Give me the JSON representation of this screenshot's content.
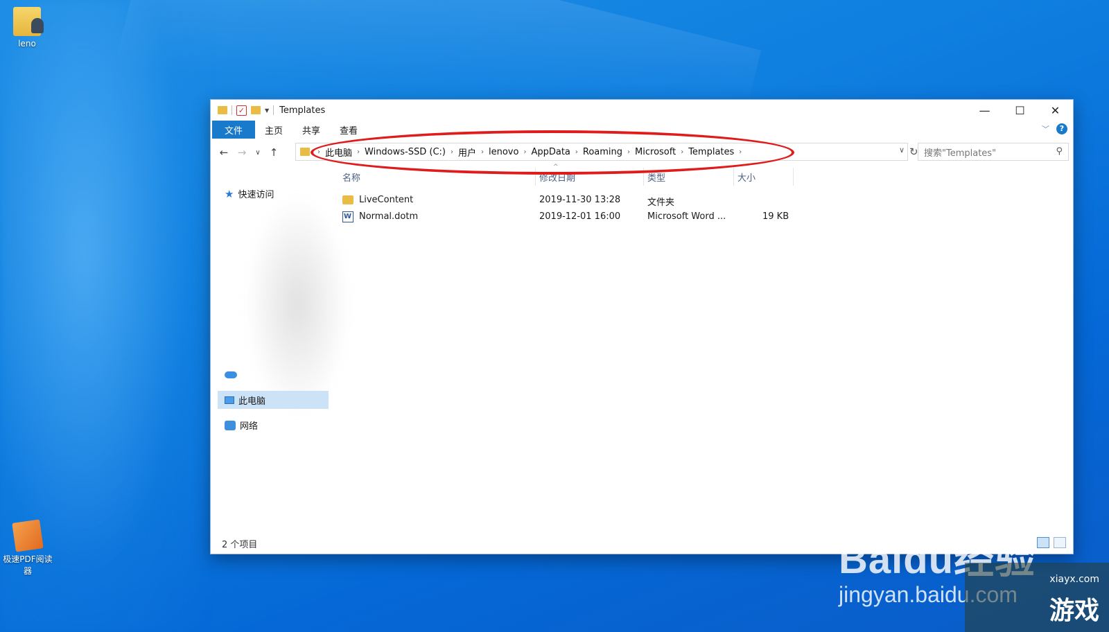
{
  "desktop": {
    "icons": [
      {
        "label": "leno"
      },
      {
        "label": "极速PDF阅读器"
      }
    ]
  },
  "window": {
    "title": "Templates",
    "controls": {
      "minimize": "—",
      "maximize": "☐",
      "close": "✕"
    }
  },
  "ribbon": {
    "tabs": [
      "文件",
      "主页",
      "共享",
      "查看"
    ],
    "help": "?"
  },
  "address": {
    "crumbs": [
      "此电脑",
      "Windows-SSD (C:)",
      "用户",
      "lenovo",
      "AppData",
      "Roaming",
      "Microsoft",
      "Templates"
    ],
    "separator": "›"
  },
  "search": {
    "placeholder": "搜索\"Templates\""
  },
  "nav": {
    "quick_access": "快速访问",
    "this_pc": "此电脑",
    "network": "网络"
  },
  "columns": {
    "name": "名称",
    "modified": "修改日期",
    "type": "类型",
    "size": "大小"
  },
  "files": [
    {
      "name": "LiveContent",
      "modified": "2019-11-30 13:28",
      "type": "文件夹",
      "size": "",
      "icon": "folder-icon"
    },
    {
      "name": "Normal.dotm",
      "modified": "2019-12-01 16:00",
      "type": "Microsoft Word ...",
      "size": "19 KB",
      "icon": "word-template-icon"
    }
  ],
  "status": {
    "count": "2 个项目"
  },
  "watermark": {
    "brand": "Baidu经验",
    "url": "jingyan.baidu.com"
  },
  "corner_logo": {
    "site": "xiayx.com",
    "text": "游戏"
  },
  "colors": {
    "accent": "#1979ca",
    "annotation": "#e01b1b",
    "selection": "#cce2f7"
  }
}
